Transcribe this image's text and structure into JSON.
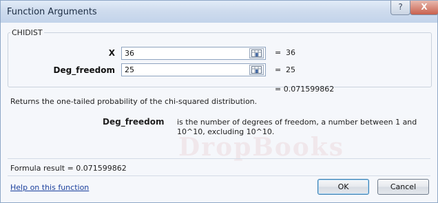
{
  "window": {
    "title": "Function Arguments",
    "help_glyph": "?",
    "close_glyph": "X"
  },
  "function": {
    "name": "CHIDIST",
    "args": [
      {
        "label": "X",
        "value": "36",
        "result": "36"
      },
      {
        "label": "Deg_freedom",
        "value": "25",
        "result": "25"
      }
    ],
    "eq_sign": "=",
    "result": "= 0.071599862",
    "description": "Returns the one-tailed probability of the chi-squared distribution.",
    "arg_help_name": "Deg_freedom",
    "arg_help_text": "is the number of degrees of freedom, a number between 1 and 10^10, excluding 10^10."
  },
  "footer": {
    "formula_result": "Formula result =  0.071599862",
    "help_link": "Help on this function",
    "ok_label": "OK",
    "cancel_label": "Cancel"
  },
  "watermark": "DropBooks"
}
